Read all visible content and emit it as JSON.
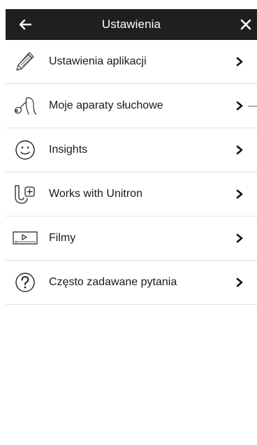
{
  "header": {
    "title": "Ustawienia",
    "back_icon": "arrow-left-icon",
    "close_icon": "close-icon",
    "background_color": "#1f1f1f",
    "text_color": "#ffffff"
  },
  "menu": {
    "items": [
      {
        "label": "Ustawienia aplikacji",
        "icon": "pencil-icon"
      },
      {
        "label": "Moje aparaty słuchowe",
        "icon": "hearing-aids-icon"
      },
      {
        "label": "Insights",
        "icon": "smiley-icon"
      },
      {
        "label": "Works with Unitron",
        "icon": "unitron-icon"
      },
      {
        "label": "Filmy",
        "icon": "video-icon"
      },
      {
        "label": "Często zadawane pytania",
        "icon": "question-icon"
      }
    ],
    "chevron_icon": "chevron-right-icon"
  }
}
